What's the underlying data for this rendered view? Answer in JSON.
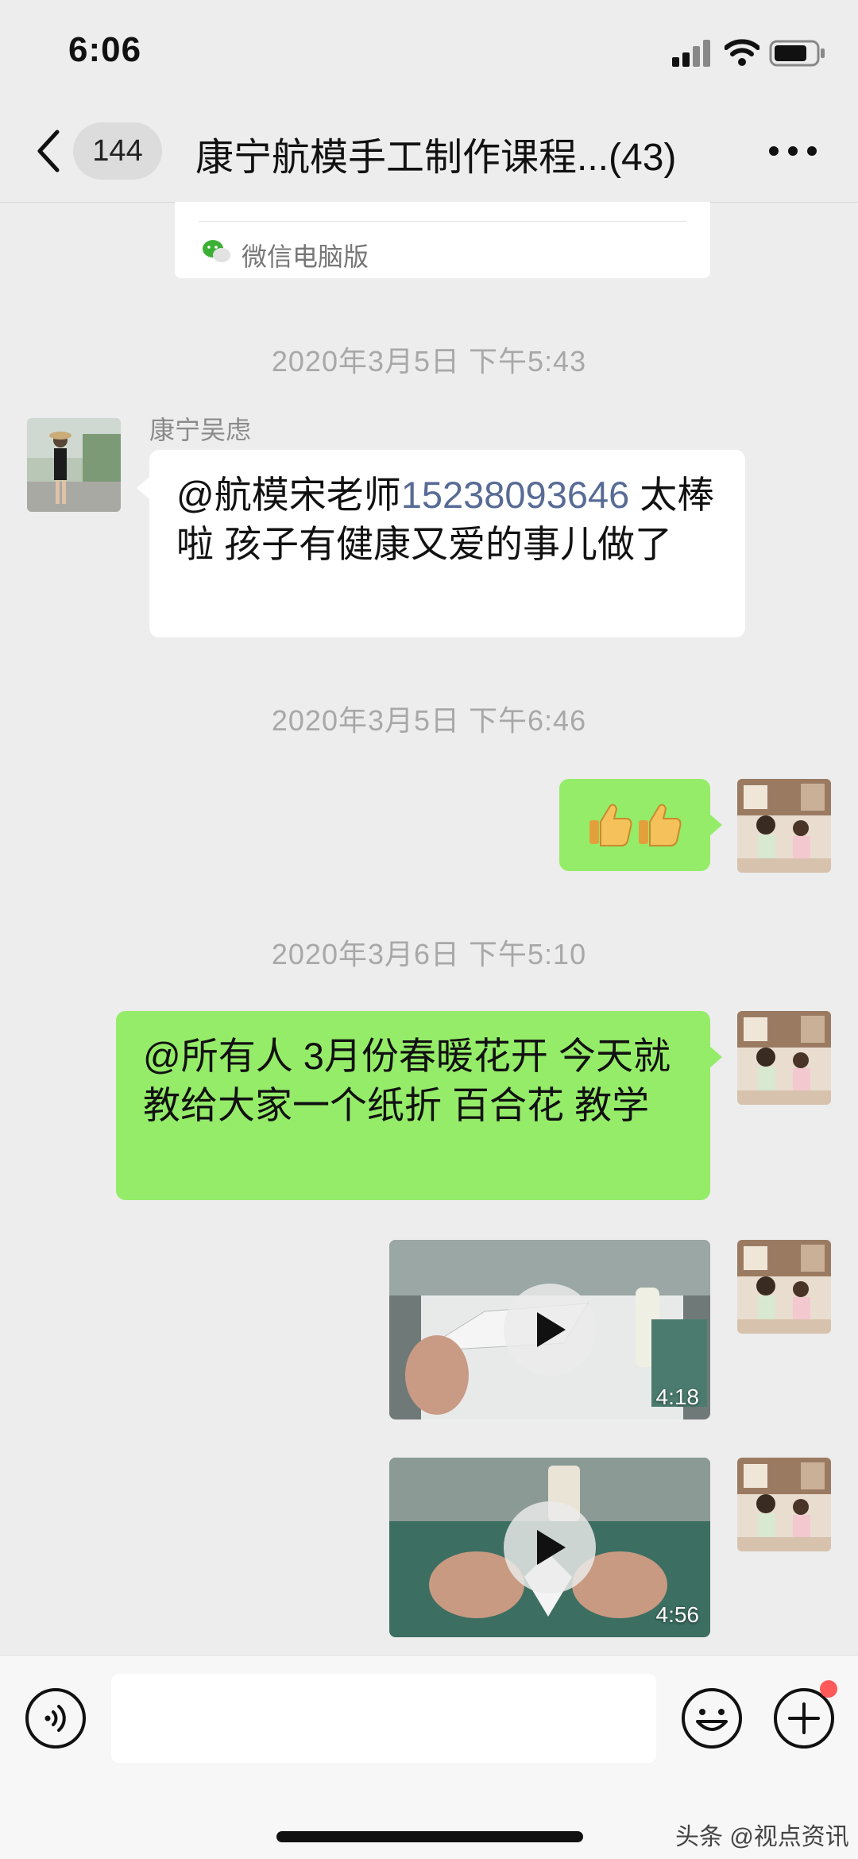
{
  "status_bar": {
    "time": "6:06"
  },
  "nav": {
    "unread_count": "144",
    "title": "康宁航模手工制作课程...(43)"
  },
  "card": {
    "source": "微信电脑版"
  },
  "messages": {
    "ts1": "2020年3月5日 下午5:43",
    "sender1_name": "康宁吴虑",
    "msg1_mention": "@航模宋老师",
    "msg1_phone": "15238093646",
    "msg1_rest": " 太棒啦 孩子有健康又爱的事儿做了",
    "ts2": "2020年3月5日 下午6:46",
    "msg2_emoji": "👍👍",
    "ts3": "2020年3月6日 下午5:10",
    "msg3_text": "@所有人 3月份春暖花开 今天就教给大家一个纸折 百合花 教学",
    "video1_duration": "4:18",
    "video2_duration": "4:56"
  },
  "watermark": "头条 @视点资讯",
  "icons": {
    "back": "chevron-left-icon",
    "more": "more-dots-icon",
    "voice": "voice-icon",
    "emoji": "emoji-icon",
    "plus": "plus-icon",
    "play": "play-icon"
  },
  "colors": {
    "background": "#ededed",
    "bubble_green": "#95ec69",
    "bubble_white": "#ffffff",
    "mention": "#576b95",
    "timestamp": "#a8a8a8"
  }
}
